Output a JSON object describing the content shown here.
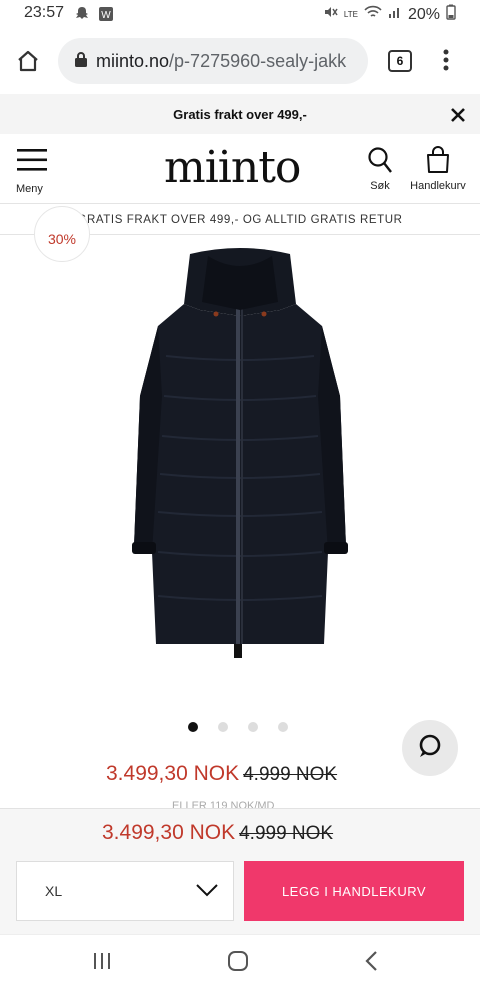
{
  "status_bar": {
    "time": "23:57",
    "battery": "20%",
    "network_label": "LTE"
  },
  "browser": {
    "url_host": "miinto.no",
    "url_path": "/p-7275960-sealy-jakk",
    "tab_count": "6"
  },
  "promo_bar": {
    "text": "Gratis frakt over 499,-"
  },
  "header": {
    "logo": "miinto",
    "menu_label": "Meny",
    "search_label": "Søk",
    "cart_label": "Handlekurv"
  },
  "shipping_banner": {
    "text": "GRATIS FRAKT OVER 499,- OG ALLTID GRATIS RETUR"
  },
  "product": {
    "discount_badge": "30%",
    "image_count": 4,
    "active_image": 0,
    "price_now": "3.499,30 NOK",
    "price_old": "4.999 NOK",
    "klarna_text": "ELLER 119 NOK/MD"
  },
  "sticky_bar": {
    "price_now": "3.499,30 NOK",
    "price_old": "4.999 NOK",
    "size_selected": "XL",
    "add_to_cart_label": "LEGG I HANDLEKURV"
  },
  "colors": {
    "accent": "#f0386b",
    "price_red": "#c0392b"
  },
  "icons": {
    "home": "home-icon",
    "lock": "lock-icon",
    "menu": "hamburger-icon",
    "search": "search-icon",
    "cart": "shopping-bag-icon",
    "chat": "chat-icon",
    "close": "close-icon"
  }
}
